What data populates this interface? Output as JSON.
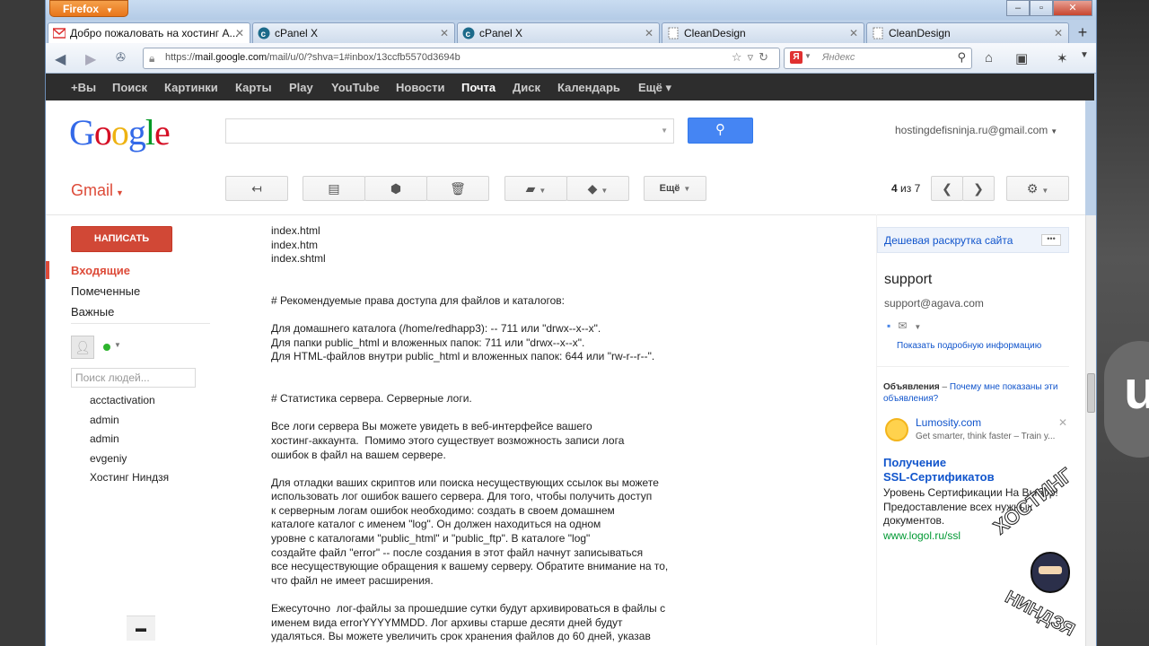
{
  "browser": {
    "menu_label": "Firefox",
    "tabs": [
      {
        "title": "Добро пожаловать на хостинг А...",
        "icon": "gmail-icon"
      },
      {
        "title": "cPanel X",
        "icon": "cpanel-icon"
      },
      {
        "title": "cPanel X",
        "icon": "cpanel-icon"
      },
      {
        "title": "CleanDesign",
        "icon": "page-icon"
      },
      {
        "title": "CleanDesign",
        "icon": "page-icon"
      }
    ],
    "url_scheme": "https://",
    "url_host": "mail.google.com",
    "url_path": "/mail/u/0/?shva=1#inbox/13ccfb5570d3694b",
    "search_placeholder": "Яндекс",
    "search_engine_letter": "Я"
  },
  "gbar": {
    "items": [
      "+Вы",
      "Поиск",
      "Картинки",
      "Карты",
      "Play",
      "YouTube",
      "Новости",
      "Почта",
      "Диск",
      "Календарь",
      "Ещё ▾"
    ],
    "current": "Почта"
  },
  "header": {
    "logo": [
      "G",
      "o",
      "o",
      "g",
      "l",
      "e"
    ],
    "account": "hostingdefisninja.ru@gmail.com"
  },
  "toolbar": {
    "app_label": "Gmail",
    "more_label": "Ещё",
    "counter_current": "4",
    "counter_rest": "из 7"
  },
  "sidebar": {
    "compose_label": "НАПИСАТЬ",
    "links": [
      "Входящие",
      "Помеченные",
      "Важные"
    ],
    "people_search_placeholder": "Поиск людей...",
    "contacts": [
      "acctactivation",
      "admin",
      "admin",
      "evgeniy",
      "Хостинг Ниндзя"
    ]
  },
  "message": {
    "body": "index.html\nindex.htm\nindex.shtml\n\n\n# Рекомендуемые права доступа для файлов и каталогов:\n\nДля домашнего каталога (/home/redhapp3): -- 711 или \"drwx--x--x\".\nДля папки public_html и вложенных папок: 711 или \"drwx--x--x\".\nДля HTML-файлов внутри public_html и вложенных папок: 644 или \"rw-r--r--\".\n\n\n# Статистика сервера. Серверные логи.\n\nВсе логи сервера Вы можете увидеть в веб-интерфейсе вашего\nхостинг-аккаунта.  Помимо этого существует возможность записи лога\nошибок в файл на вашем сервере.\n\nДля отладки ваших скриптов или поиска несуществующих ссылок вы можете\nиспользовать лог ошибок вашего сервера. Для того, чтобы получить доступ\nк серверным логам ошибок необходимо: создать в своем домашнем\nкаталоге каталог с именем \"log\". Он должен находиться на одном\nуровне с каталогами \"public_html\" и \"public_ftp\". В каталоге \"log\"\nсоздайте файл \"error\" -- после создания в этот файл начнут записываться\nвсе несуществующие обращения к вашему серверу. Обратите внимание на то,\nчто файл не имеет расширения.\n\nЕжесуточно  лог-файлы за прошедшие сутки будут архивироваться в файлы с\nименем вида errorYYYYMMDD. Лог архивы старше десяти дней будут\nудаляться. Вы можете увеличить срок хранения файлов до 60 дней, указав"
  },
  "right_panel": {
    "top_ad": "Дешевая раскрутка сайта",
    "sender_name": "support",
    "sender_email": "support@agava.com",
    "sender_more": "Показать подробную информацию",
    "ads_heading": "Объявления",
    "ads_dash": " – ",
    "ads_why": "Почему мне показаны эти объявления?",
    "ad1_title": "Lumosity.com",
    "ad1_desc": "Get smarter, think faster – Train y...",
    "ad2_title_1": "Получение",
    "ad2_title_2": "SSL-Сертификатов",
    "ad2_desc": "Уровень Сертификации На Выбор! Предоставление всех нужных документов.",
    "ad2_url": "www.logol.ru/ssl"
  },
  "watermark": {
    "line1": "ХОСТИНГ",
    "line2": "НИНДЗЯ"
  },
  "colors": {
    "gmail_red": "#dd4b39",
    "compose_red": "#d14836",
    "link_blue": "#1155cc",
    "search_blue": "#4585f3",
    "gbar_bg": "#2d2d2d"
  }
}
